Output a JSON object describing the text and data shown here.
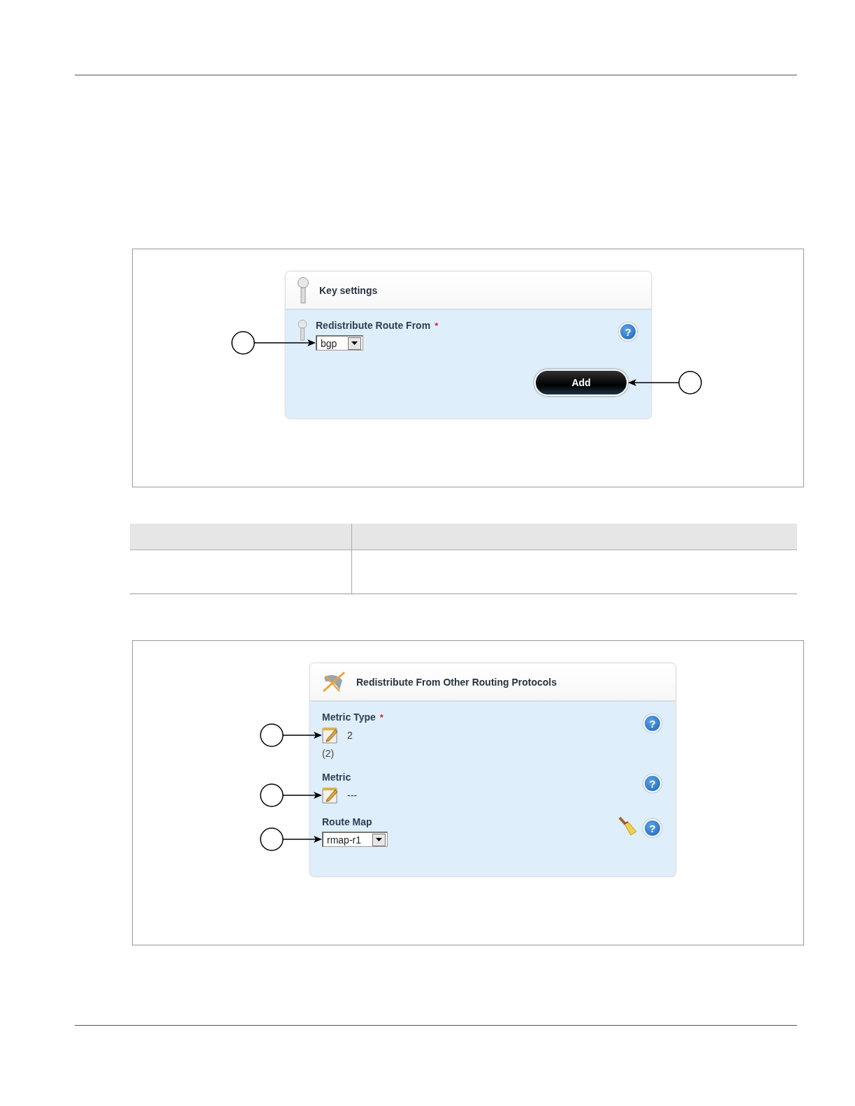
{
  "figures": [
    {
      "panel": {
        "title": "Key settings",
        "fields": [
          {
            "kind": "select",
            "label": "Redistribute Route From",
            "required_mark": "*",
            "value": "bgp",
            "help": "?"
          }
        ],
        "button": {
          "label": "Add"
        }
      }
    },
    {
      "panel": {
        "title": "Redistribute From Other Routing Protocols",
        "fields": [
          {
            "kind": "edit",
            "label": "Metric Type",
            "required_mark": "*",
            "value": "2",
            "note": "(2)",
            "help": "?"
          },
          {
            "kind": "edit",
            "label": "Metric",
            "value": "---",
            "help": "?"
          },
          {
            "kind": "select",
            "label": "Route Map",
            "value": "rmap-r1",
            "help": "?"
          }
        ]
      }
    }
  ]
}
